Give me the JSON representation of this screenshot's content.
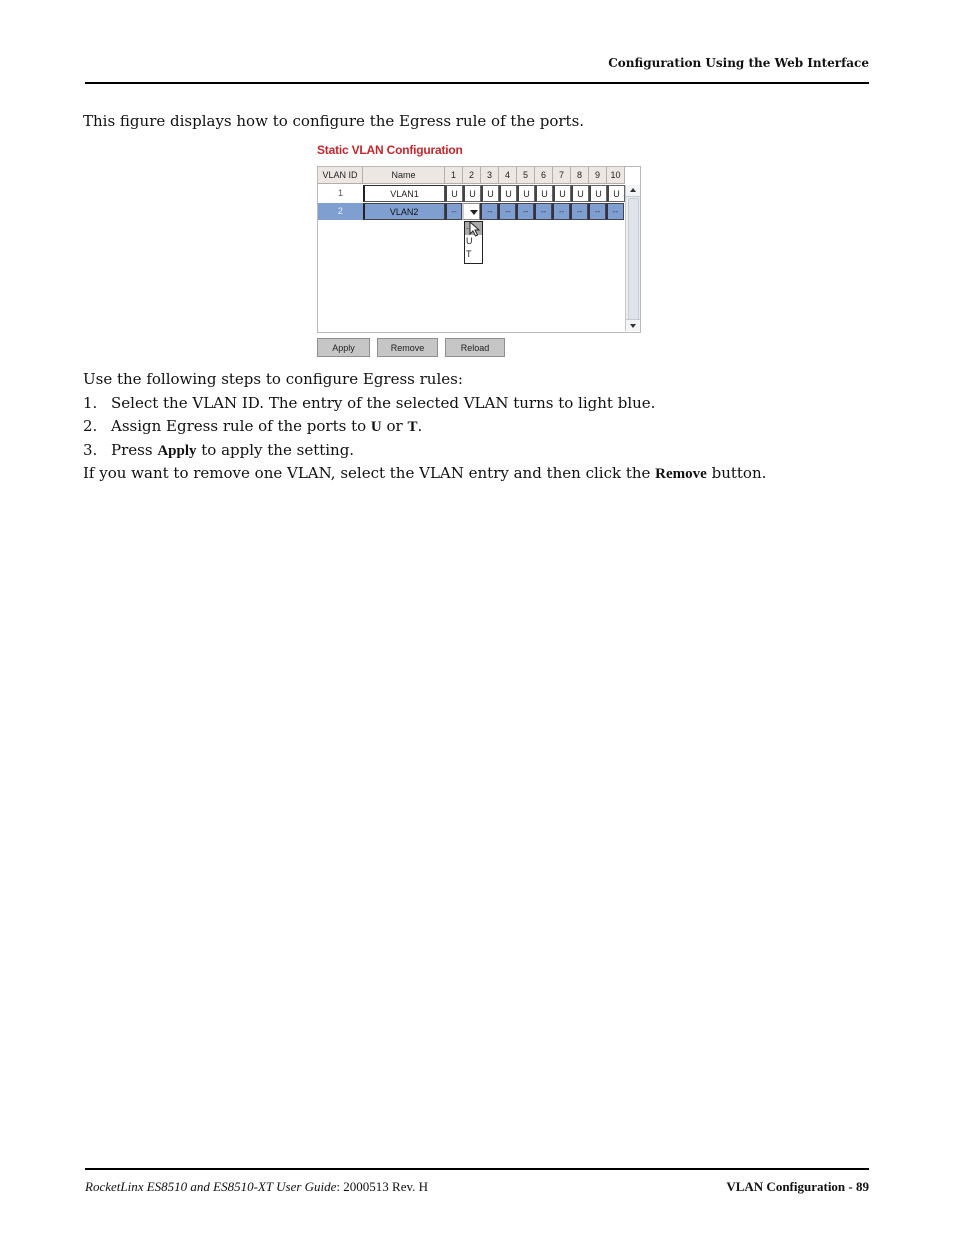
{
  "header": {
    "running_title": "Configuration Using the Web Interface"
  },
  "intro": "This figure displays how to configure the Egress rule of the ports.",
  "figure": {
    "title": "Static VLAN Configuration",
    "columns": {
      "vlan_id": "VLAN ID",
      "name": "Name",
      "ports": [
        "1",
        "2",
        "3",
        "4",
        "5",
        "6",
        "7",
        "8",
        "9",
        "10"
      ]
    },
    "rows": [
      {
        "vlan_id": "1",
        "name": "VLAN1",
        "ports": [
          "U",
          "U",
          "U",
          "U",
          "U",
          "U",
          "U",
          "U",
          "U",
          "U"
        ],
        "selected": false
      },
      {
        "vlan_id": "2",
        "name": "VLAN2",
        "ports": [
          "--",
          "",
          "--",
          "--",
          "--",
          "--",
          "--",
          "--",
          "--",
          "--"
        ],
        "selected": true
      }
    ],
    "dropdown": {
      "open_on_port": "2",
      "options": [
        "--",
        "U",
        "T"
      ],
      "highlighted": "--"
    },
    "colors": {
      "title": "#c0282d",
      "selected_row": "#7f9fd1"
    },
    "buttons": {
      "apply": "Apply",
      "remove": "Remove",
      "reload": "Reload"
    }
  },
  "steps": {
    "intro": "Use the following steps to configure Egress rules:",
    "items": [
      {
        "num": "1.",
        "text": "Select the VLAN ID. The entry of the selected VLAN turns to light blue."
      },
      {
        "num": "2.",
        "pre": "Assign Egress rule of the ports to ",
        "b1": "U",
        "mid": " or ",
        "b2": "T",
        "post": "."
      },
      {
        "num": "3.",
        "pre": "Press ",
        "b1": "Apply",
        "post": " to apply the setting."
      }
    ],
    "remove_note": {
      "pre": "If you want to remove one VLAN, select the VLAN entry and then click the ",
      "bold": "Remove",
      "post": " button."
    }
  },
  "footer": {
    "guide_title": "RocketLinx ES8510  and ES8510-XT User Guide",
    "doc_number": ": 2000513 Rev. H",
    "section": "VLAN Configuration - 89"
  }
}
